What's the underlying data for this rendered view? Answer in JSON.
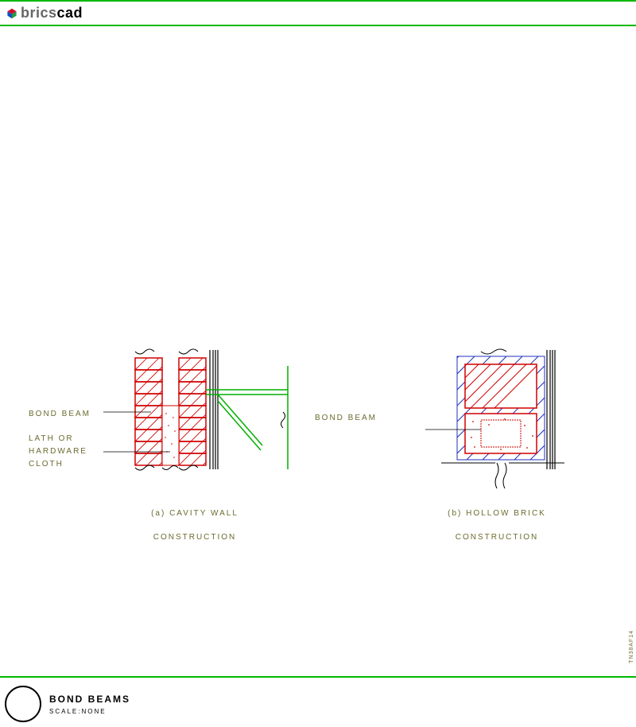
{
  "logo": {
    "brand_prefix": "brics",
    "brand_suffix": "cad"
  },
  "labels": {
    "bond_beam_left": "BOND BEAM",
    "lath_line1": "LATH OR",
    "lath_line2": "HARDWARE",
    "lath_line3": "CLOTH",
    "bond_beam_center": "BOND BEAM",
    "section_a_line1": "(a) CAVITY WALL",
    "section_a_line2": "CONSTRUCTION",
    "section_b_line1": "(b) HOLLOW BRICK",
    "section_b_line2": "CONSTRUCTION"
  },
  "titleblock": {
    "title": "BOND BEAMS",
    "scale": "SCALE:NONE"
  },
  "side_ref": "TN38AF14"
}
